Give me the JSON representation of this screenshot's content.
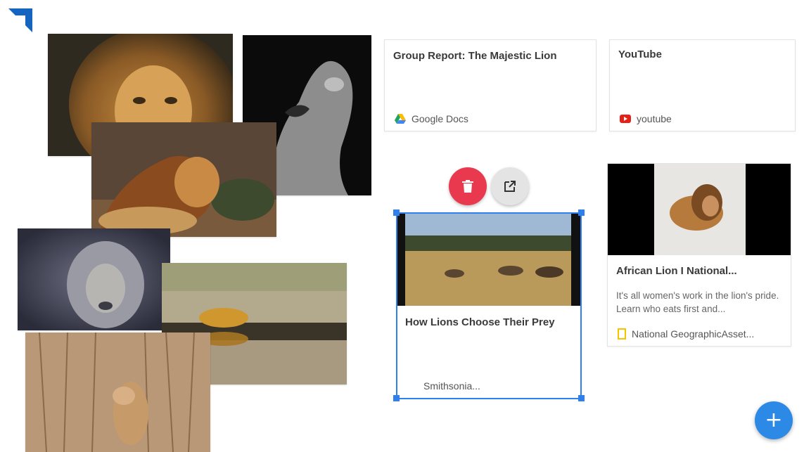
{
  "cards": [
    {
      "title": "Group Report: The Majestic Lion",
      "source": "Google Docs",
      "icon": "google-docs-icon"
    },
    {
      "title": "YouTube",
      "source": "youtube",
      "icon": "youtube-icon"
    },
    {
      "title": "How Lions Choose Their Prey",
      "source": "Smithsonia...",
      "icon": "none"
    },
    {
      "title": "African Lion I National...",
      "description": "It's all women's work in the lion's pride. Learn who eats first and...",
      "source": "National GeographicAsset...",
      "icon": "natgeo-icon"
    }
  ],
  "toolbar": {
    "delete_icon": "trash-icon",
    "open_icon": "open-external-icon"
  },
  "fab": {
    "label": "+"
  },
  "colors": {
    "accent": "#2f80ed",
    "delete": "#e8394f",
    "fab": "#2c8ae6"
  }
}
